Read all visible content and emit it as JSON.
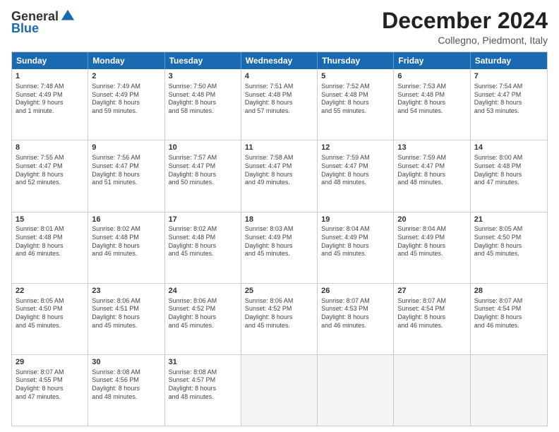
{
  "header": {
    "logo_general": "General",
    "logo_blue": "Blue",
    "month_title": "December 2024",
    "subtitle": "Collegno, Piedmont, Italy"
  },
  "weekdays": [
    "Sunday",
    "Monday",
    "Tuesday",
    "Wednesday",
    "Thursday",
    "Friday",
    "Saturday"
  ],
  "rows": [
    [
      {
        "day": "1",
        "content": "Sunrise: 7:48 AM\nSunset: 4:49 PM\nDaylight: 9 hours\nand 1 minute."
      },
      {
        "day": "2",
        "content": "Sunrise: 7:49 AM\nSunset: 4:49 PM\nDaylight: 8 hours\nand 59 minutes."
      },
      {
        "day": "3",
        "content": "Sunrise: 7:50 AM\nSunset: 4:48 PM\nDaylight: 8 hours\nand 58 minutes."
      },
      {
        "day": "4",
        "content": "Sunrise: 7:51 AM\nSunset: 4:48 PM\nDaylight: 8 hours\nand 57 minutes."
      },
      {
        "day": "5",
        "content": "Sunrise: 7:52 AM\nSunset: 4:48 PM\nDaylight: 8 hours\nand 55 minutes."
      },
      {
        "day": "6",
        "content": "Sunrise: 7:53 AM\nSunset: 4:48 PM\nDaylight: 8 hours\nand 54 minutes."
      },
      {
        "day": "7",
        "content": "Sunrise: 7:54 AM\nSunset: 4:47 PM\nDaylight: 8 hours\nand 53 minutes."
      }
    ],
    [
      {
        "day": "8",
        "content": "Sunrise: 7:55 AM\nSunset: 4:47 PM\nDaylight: 8 hours\nand 52 minutes."
      },
      {
        "day": "9",
        "content": "Sunrise: 7:56 AM\nSunset: 4:47 PM\nDaylight: 8 hours\nand 51 minutes."
      },
      {
        "day": "10",
        "content": "Sunrise: 7:57 AM\nSunset: 4:47 PM\nDaylight: 8 hours\nand 50 minutes."
      },
      {
        "day": "11",
        "content": "Sunrise: 7:58 AM\nSunset: 4:47 PM\nDaylight: 8 hours\nand 49 minutes."
      },
      {
        "day": "12",
        "content": "Sunrise: 7:59 AM\nSunset: 4:47 PM\nDaylight: 8 hours\nand 48 minutes."
      },
      {
        "day": "13",
        "content": "Sunrise: 7:59 AM\nSunset: 4:47 PM\nDaylight: 8 hours\nand 48 minutes."
      },
      {
        "day": "14",
        "content": "Sunrise: 8:00 AM\nSunset: 4:48 PM\nDaylight: 8 hours\nand 47 minutes."
      }
    ],
    [
      {
        "day": "15",
        "content": "Sunrise: 8:01 AM\nSunset: 4:48 PM\nDaylight: 8 hours\nand 46 minutes."
      },
      {
        "day": "16",
        "content": "Sunrise: 8:02 AM\nSunset: 4:48 PM\nDaylight: 8 hours\nand 46 minutes."
      },
      {
        "day": "17",
        "content": "Sunrise: 8:02 AM\nSunset: 4:48 PM\nDaylight: 8 hours\nand 45 minutes."
      },
      {
        "day": "18",
        "content": "Sunrise: 8:03 AM\nSunset: 4:49 PM\nDaylight: 8 hours\nand 45 minutes."
      },
      {
        "day": "19",
        "content": "Sunrise: 8:04 AM\nSunset: 4:49 PM\nDaylight: 8 hours\nand 45 minutes."
      },
      {
        "day": "20",
        "content": "Sunrise: 8:04 AM\nSunset: 4:49 PM\nDaylight: 8 hours\nand 45 minutes."
      },
      {
        "day": "21",
        "content": "Sunrise: 8:05 AM\nSunset: 4:50 PM\nDaylight: 8 hours\nand 45 minutes."
      }
    ],
    [
      {
        "day": "22",
        "content": "Sunrise: 8:05 AM\nSunset: 4:50 PM\nDaylight: 8 hours\nand 45 minutes."
      },
      {
        "day": "23",
        "content": "Sunrise: 8:06 AM\nSunset: 4:51 PM\nDaylight: 8 hours\nand 45 minutes."
      },
      {
        "day": "24",
        "content": "Sunrise: 8:06 AM\nSunset: 4:52 PM\nDaylight: 8 hours\nand 45 minutes."
      },
      {
        "day": "25",
        "content": "Sunrise: 8:06 AM\nSunset: 4:52 PM\nDaylight: 8 hours\nand 45 minutes."
      },
      {
        "day": "26",
        "content": "Sunrise: 8:07 AM\nSunset: 4:53 PM\nDaylight: 8 hours\nand 46 minutes."
      },
      {
        "day": "27",
        "content": "Sunrise: 8:07 AM\nSunset: 4:54 PM\nDaylight: 8 hours\nand 46 minutes."
      },
      {
        "day": "28",
        "content": "Sunrise: 8:07 AM\nSunset: 4:54 PM\nDaylight: 8 hours\nand 46 minutes."
      }
    ],
    [
      {
        "day": "29",
        "content": "Sunrise: 8:07 AM\nSunset: 4:55 PM\nDaylight: 8 hours\nand 47 minutes."
      },
      {
        "day": "30",
        "content": "Sunrise: 8:08 AM\nSunset: 4:56 PM\nDaylight: 8 hours\nand 48 minutes."
      },
      {
        "day": "31",
        "content": "Sunrise: 8:08 AM\nSunset: 4:57 PM\nDaylight: 8 hours\nand 48 minutes."
      },
      {
        "day": "",
        "content": ""
      },
      {
        "day": "",
        "content": ""
      },
      {
        "day": "",
        "content": ""
      },
      {
        "day": "",
        "content": ""
      }
    ]
  ]
}
